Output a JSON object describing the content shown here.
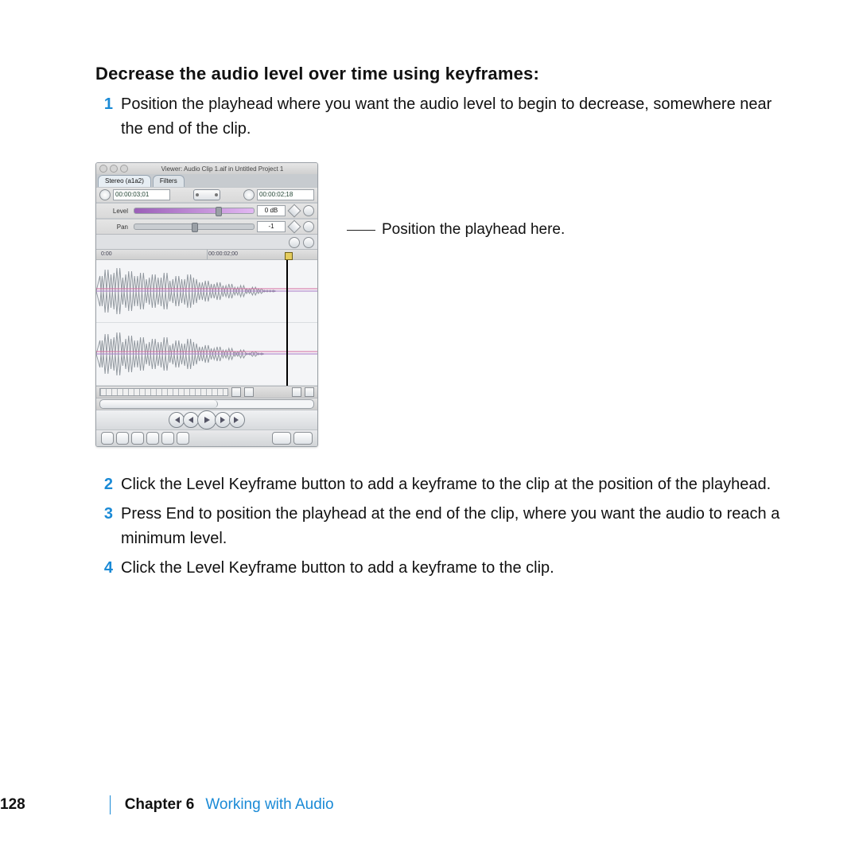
{
  "heading": "Decrease the audio level over time using keyframes:",
  "steps": [
    {
      "n": "1",
      "t": "Position the playhead where you want the audio level to begin to decrease, somewhere near the end of the clip."
    },
    {
      "n": "2",
      "t": "Click the Level Keyframe button to add a keyframe to the clip at the position of the playhead."
    },
    {
      "n": "3",
      "t": "Press End to position the playhead at the end of the clip, where you want the audio to reach a minimum level."
    },
    {
      "n": "4",
      "t": "Click the Level Keyframe button to add a keyframe to the clip."
    }
  ],
  "callout": "Position the playhead here.",
  "viewer": {
    "title": "Viewer: Audio Clip 1.aif in Untitled Project 1",
    "tabs": {
      "stereo": "Stereo (a1a2)",
      "filters": "Filters"
    },
    "tc_left": "00:00:03;01",
    "tc_right": "00:00:02;18",
    "level_label": "Level",
    "level_value": "0 dB",
    "pan_label": "Pan",
    "pan_value": "-1",
    "ruler_start": "0:00",
    "ruler_mid": "00:00:02;00"
  },
  "footer": {
    "page": "128",
    "chapter_label": "Chapter 6",
    "chapter_title": "Working with Audio"
  }
}
